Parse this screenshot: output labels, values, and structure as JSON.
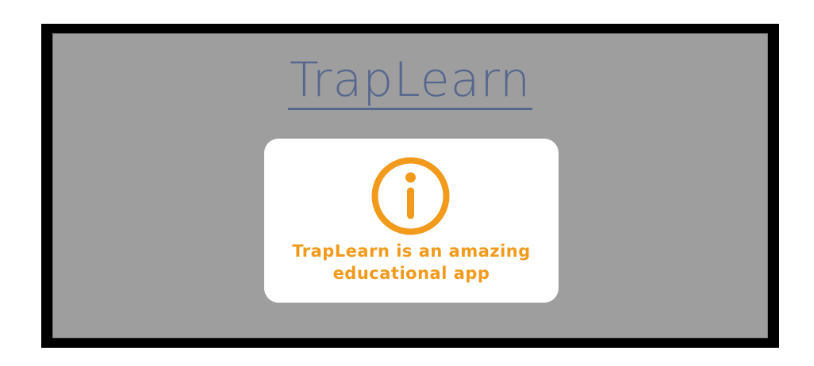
{
  "app": {
    "title": "TrapLearn"
  },
  "info_card": {
    "icon": "info-icon",
    "message": "TrapLearn is an amazing educational app"
  },
  "colors": {
    "title": "#55668f",
    "accent": "#f29a1c",
    "panel_background": "#9e9e9e",
    "frame": "#000000",
    "card_background": "#ffffff"
  }
}
